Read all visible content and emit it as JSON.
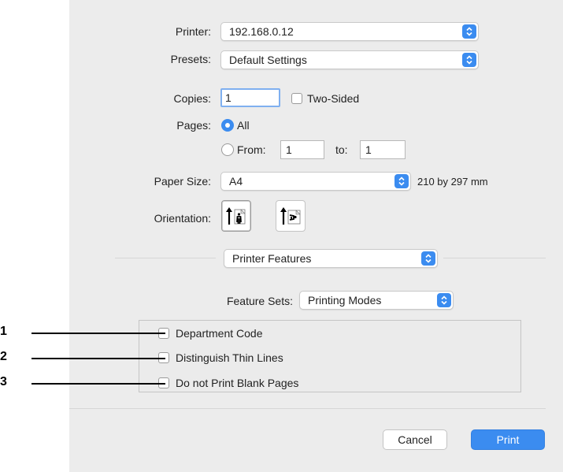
{
  "printer": {
    "label": "Printer:",
    "value": "192.168.0.12"
  },
  "presets": {
    "label": "Presets:",
    "value": "Default Settings"
  },
  "copies": {
    "label": "Copies:",
    "value": "1",
    "two_sided_label": "Two-Sided"
  },
  "pages": {
    "label": "Pages:",
    "all_label": "All",
    "from_label": "From:",
    "from_value": "1",
    "to_label": "to:",
    "to_value": "1"
  },
  "paper_size": {
    "label": "Paper Size:",
    "value": "A4",
    "dimensions": "210 by 297 mm"
  },
  "orientation": {
    "label": "Orientation:",
    "options": [
      "portrait-icon",
      "landscape-icon"
    ]
  },
  "section_menu": {
    "value": "Printer Features"
  },
  "feature_sets": {
    "label": "Feature Sets:",
    "value": "Printing Modes"
  },
  "options": [
    {
      "label": "Department Code",
      "checked": false
    },
    {
      "label": "Distinguish Thin Lines",
      "checked": false
    },
    {
      "label": "Do not Print Blank Pages",
      "checked": false
    }
  ],
  "callouts": [
    "1",
    "2",
    "3"
  ],
  "buttons": {
    "cancel": "Cancel",
    "print": "Print"
  },
  "colors": {
    "accent": "#3b8cf0",
    "dialog_bg": "#ececec"
  }
}
